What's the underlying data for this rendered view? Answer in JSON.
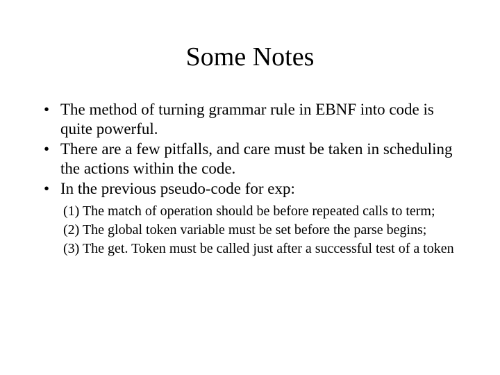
{
  "title": "Some Notes",
  "bullets": [
    "The method of turning grammar rule in EBNF into code is quite powerful.",
    "There are a few pitfalls, and care must be taken in scheduling the actions within the code.",
    "In the previous pseudo-code for exp:"
  ],
  "subitems": [
    "(1) The match of operation should be before repeated calls to term;",
    "(2) The global token variable must be set before the parse begins;",
    "(3) The get. Token must be called just after a successful test of a token"
  ]
}
